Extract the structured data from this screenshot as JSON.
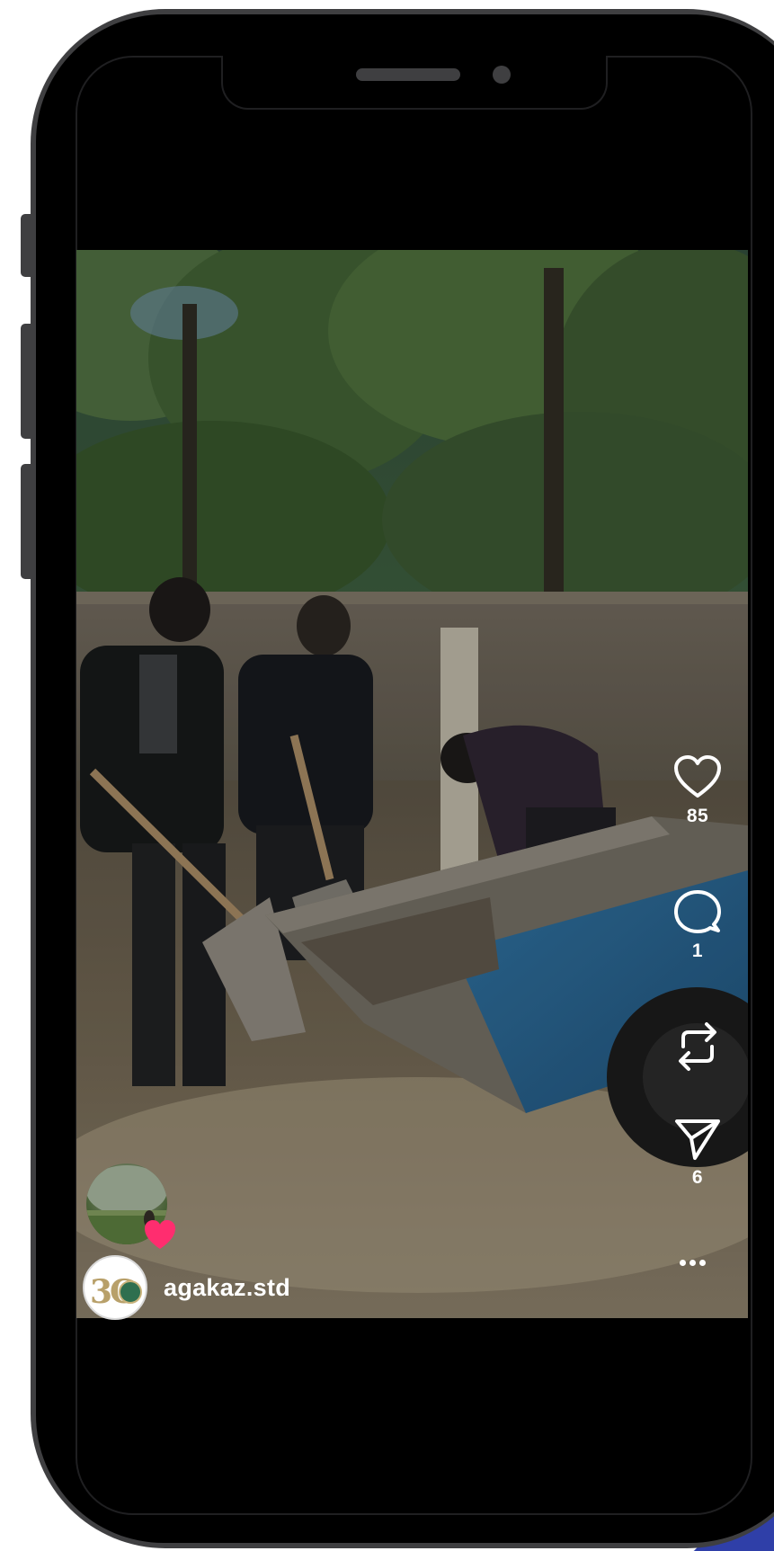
{
  "app": {
    "type": "reel-viewer"
  },
  "reel": {
    "username": "agakaz.std",
    "likes": "85",
    "comments": "1",
    "shares": "6"
  },
  "icons": {
    "like": "heart-icon",
    "comment": "comment-bubble-icon",
    "repost": "repost-icon",
    "share": "send-icon",
    "more": "more-options-icon",
    "audio": "audio-disc-icon"
  },
  "colors": {
    "phone_frame": "#3f3f41",
    "screen": "#000000",
    "text": "#ffffff",
    "heart_badge": "#ff2d6f"
  }
}
